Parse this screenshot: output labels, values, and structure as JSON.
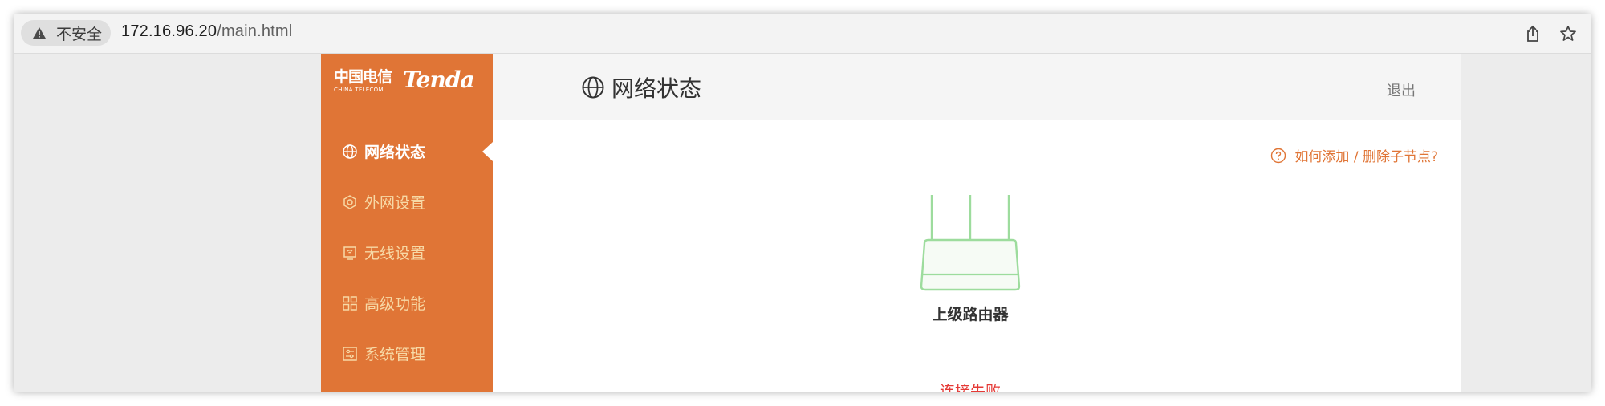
{
  "browser": {
    "security_label": "不安全",
    "url_host": "172.16.96.20",
    "url_path": "/main.html"
  },
  "sidebar": {
    "logo_ct": "中国电信",
    "logo_ct_sub": "CHINA TELECOM",
    "logo_brand": "Tenda",
    "items": [
      {
        "label": "网络状态",
        "icon": "globe-icon",
        "active": true
      },
      {
        "label": "外网设置",
        "icon": "wan-icon",
        "active": false
      },
      {
        "label": "无线设置",
        "icon": "wifi-icon",
        "active": false
      },
      {
        "label": "高级功能",
        "icon": "grid-icon",
        "active": false
      },
      {
        "label": "系统管理",
        "icon": "settings-panel-icon",
        "active": false
      }
    ]
  },
  "header": {
    "title": "网络状态",
    "logout_label": "退出"
  },
  "main": {
    "help_link": "如何添加 / 删除子节点?",
    "router_label": "上级路由器",
    "status_text": "连接失败"
  },
  "colors": {
    "accent": "#e07536",
    "menu_text": "#f7d9a6",
    "router_stroke": "#9ddc9d",
    "error": "#e53935"
  }
}
